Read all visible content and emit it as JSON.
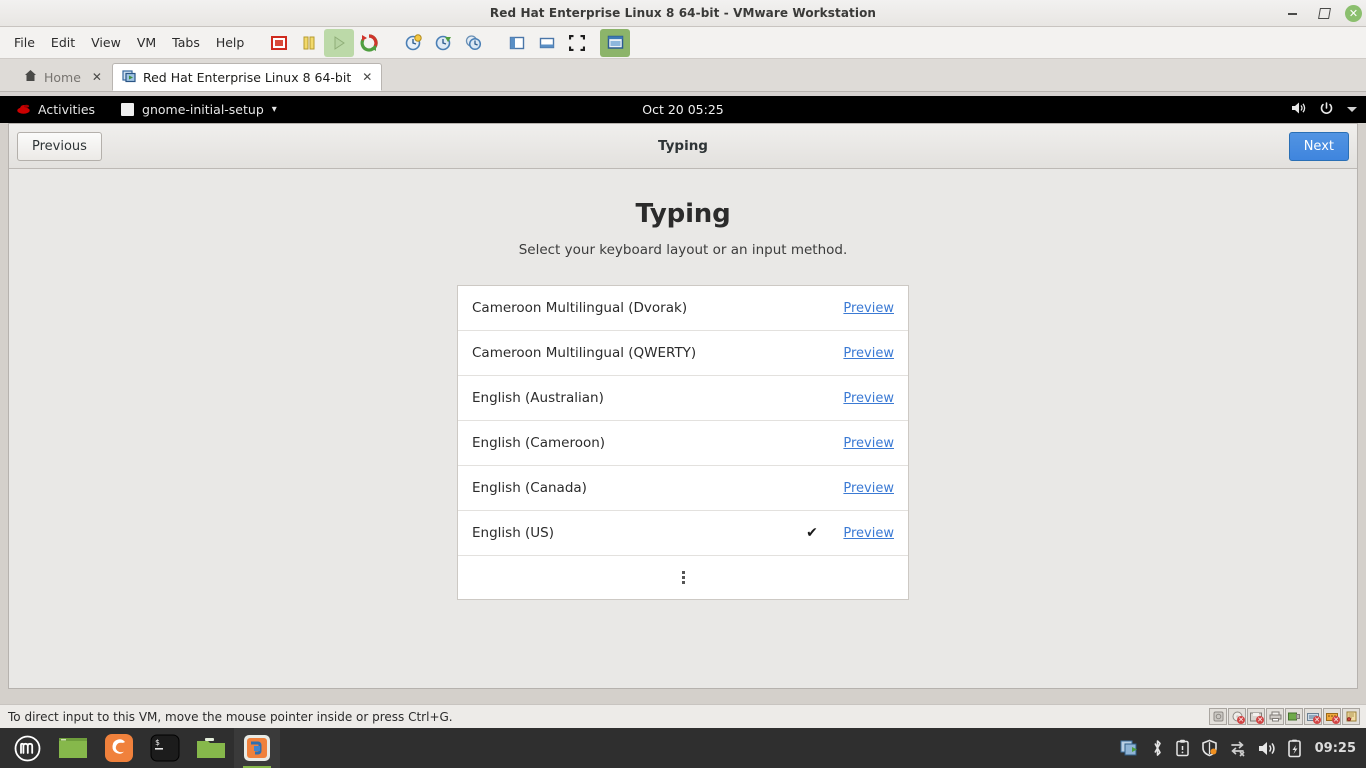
{
  "window": {
    "title": "Red Hat Enterprise Linux 8 64-bit - VMware Workstation",
    "controls": {
      "minimize": "minimize-icon",
      "restore": "restore-icon",
      "close": "close-icon"
    }
  },
  "menubar": {
    "items": [
      "File",
      "Edit",
      "View",
      "VM",
      "Tabs",
      "Help"
    ]
  },
  "toolbar": {
    "buttons": [
      {
        "name": "power-off-vm-icon",
        "title": "Power Off"
      },
      {
        "name": "suspend-vm-icon",
        "title": "Suspend"
      },
      {
        "name": "play-vm-icon",
        "title": "Power On"
      },
      {
        "name": "restart-vm-icon",
        "title": "Restart Guest"
      },
      {
        "name": "snapshot-take-icon",
        "title": "Take Snapshot"
      },
      {
        "name": "snapshot-revert-icon",
        "title": "Revert Snapshot"
      },
      {
        "name": "snapshot-manager-icon",
        "title": "Manage Snapshots"
      },
      {
        "name": "show-library-icon",
        "title": "Show Library"
      },
      {
        "name": "show-thumbnails-icon",
        "title": "Show Thumbnail Bar"
      },
      {
        "name": "fullscreen-icon",
        "title": "Enter Full Screen"
      },
      {
        "name": "unity-mode-icon",
        "title": "Unity Mode"
      }
    ]
  },
  "tabs": [
    {
      "label": "Home",
      "icon": "home-icon",
      "active": false,
      "close": "✕"
    },
    {
      "label": "Red Hat Enterprise Linux 8 64-bit",
      "icon": "vm-icon",
      "active": true,
      "close": "✕"
    }
  ],
  "guest": {
    "topbar": {
      "activities": "Activities",
      "activities_icon": "redhat-logo-icon",
      "app_name": "gnome-initial-setup",
      "app_menu_arrow": "▾",
      "clock": "Oct 20  05:25",
      "volume_icon": "volume-icon",
      "power_icon": "power-icon",
      "menu_arrow_icon": "chevron-down-icon"
    },
    "header": {
      "previous_label": "Previous",
      "title": "Typing",
      "next_label": "Next",
      "accent_color": "#4a86d8"
    },
    "page": {
      "title": "Typing",
      "subtitle": "Select your keyboard layout or an input method.",
      "preview_label": "Preview",
      "check_mark": "✔",
      "more_icon": "more-vertical-icon",
      "layouts": [
        {
          "name": "Cameroon Multilingual (Dvorak)",
          "selected": false
        },
        {
          "name": "Cameroon Multilingual (QWERTY)",
          "selected": false
        },
        {
          "name": "English (Australian)",
          "selected": false
        },
        {
          "name": "English (Cameroon)",
          "selected": false
        },
        {
          "name": "English (Canada)",
          "selected": false
        },
        {
          "name": "English (US)",
          "selected": true
        }
      ]
    }
  },
  "statusbar": {
    "message": "To direct input to this VM, move the mouse pointer inside or press Ctrl+G.",
    "devices": [
      {
        "name": "hard-disk-device-icon",
        "connected": true
      },
      {
        "name": "cd-dvd-device-icon",
        "connected": false
      },
      {
        "name": "floppy-device-icon",
        "connected": false
      },
      {
        "name": "printer-device-icon",
        "connected": true
      },
      {
        "name": "network-adapter-device-icon",
        "connected": true
      },
      {
        "name": "usb-device-icon",
        "connected": false
      },
      {
        "name": "sound-card-device-icon",
        "connected": false
      },
      {
        "name": "display-settings-icon",
        "connected": true
      }
    ]
  },
  "taskbar": {
    "launchers": [
      {
        "name": "mint-menu-button",
        "running": false
      },
      {
        "name": "show-desktop-button",
        "running": false
      },
      {
        "name": "firefox-launcher",
        "running": false
      },
      {
        "name": "terminal-launcher",
        "running": false
      },
      {
        "name": "files-launcher",
        "running": false
      },
      {
        "name": "vmware-workstation-window-button",
        "running": true
      }
    ],
    "tray": [
      {
        "name": "vmware-tray-icon"
      },
      {
        "name": "bluetooth-tray-icon"
      },
      {
        "name": "clipboard-tray-icon"
      },
      {
        "name": "update-manager-tray-icon"
      },
      {
        "name": "network-tray-icon"
      },
      {
        "name": "volume-tray-icon"
      },
      {
        "name": "battery-tray-icon"
      }
    ],
    "clock": "09:25"
  }
}
